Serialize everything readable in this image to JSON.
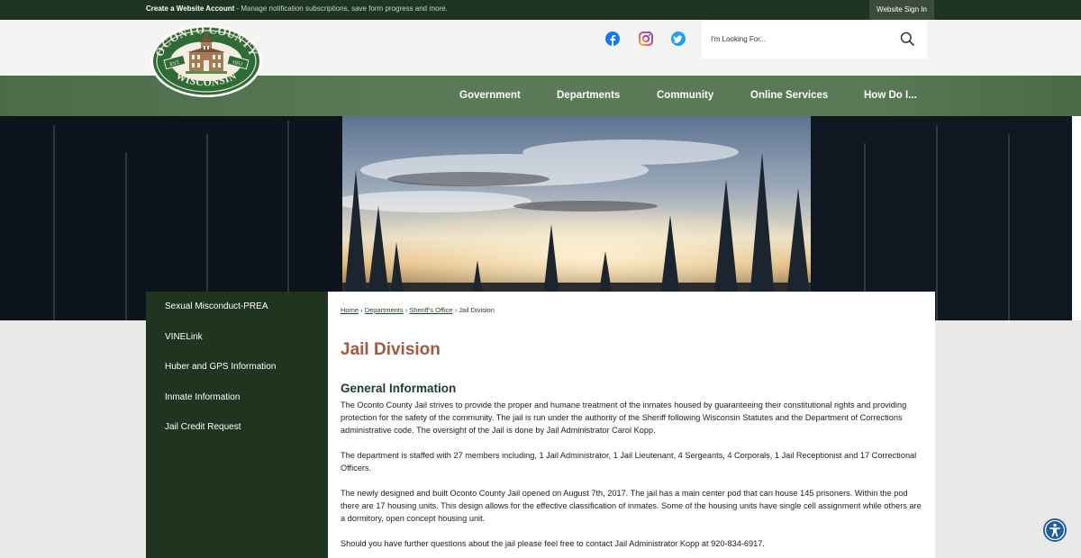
{
  "topbar": {
    "account_label": "Create a Website Account",
    "account_sub": " - Manage notification subscriptions, save form progress and more.",
    "signin": "Website Sign In"
  },
  "logo": {
    "top_text": "OCONTO COUNTY",
    "bottom_text": "WISCONSIN",
    "left_badge": "EST.",
    "right_badge": "1851"
  },
  "search": {
    "placeholder": "I'm Looking For..."
  },
  "nav": [
    "Government",
    "Departments",
    "Community",
    "Online Services",
    "How Do I..."
  ],
  "sidebar": [
    "Sexual Misconduct-PREA",
    "VINELink",
    "Huber and GPS Information",
    "Inmate Information",
    "Jail Credit Request"
  ],
  "breadcrumb": {
    "home": "Home",
    "departments": "Departments",
    "sheriff": "Sheriff's Office",
    "current": "Jail Division",
    "sep": "›"
  },
  "page": {
    "title": "Jail Division",
    "heading": "General Information",
    "paragraphs": [
      "The Oconto County Jail strives to provide the proper and humane treatment of the inmates housed by guaranteeing their constitutional rights and providing protection for the safety of the community. The jail is run under the authority of the Sheriff following Wisconsin Statutes and the Department of Corrections administrative code. The oversight of the Jail is done by Jail Administrator Carol Kopp.",
      "The department is staffed with 27 members including, 1 Jail Administrator, 1 Jail Lieutenant, 4 Sergeants, 4 Corporals, 1 Jail Receptionist and 17 Correctional Officers.",
      "The newly designed and built Oconto County Jail opened on August 7th, 2017. The jail has a main center pod that can house 145 prisoners. Within the pod there are 17 housing units. This design allows for the effective classification of inmates. Some of the housing units have single cell assignment while others are a dormitory, open concept housing unit.",
      "Should you have further questions about the jail please feel free to contact Jail Administrator Kopp at 920-834-6917."
    ]
  },
  "icons": {
    "facebook": "facebook-icon",
    "instagram": "instagram-icon",
    "twitter": "twitter-icon",
    "search": "search-icon",
    "accessibility": "accessibility-icon"
  },
  "colors": {
    "topbar": "#1f3524",
    "nav": "#5a7a58",
    "sidebar": "#1f3520",
    "title": "#a1593f",
    "heading": "#1f3d22",
    "accessibility": "#1f5fa0"
  }
}
